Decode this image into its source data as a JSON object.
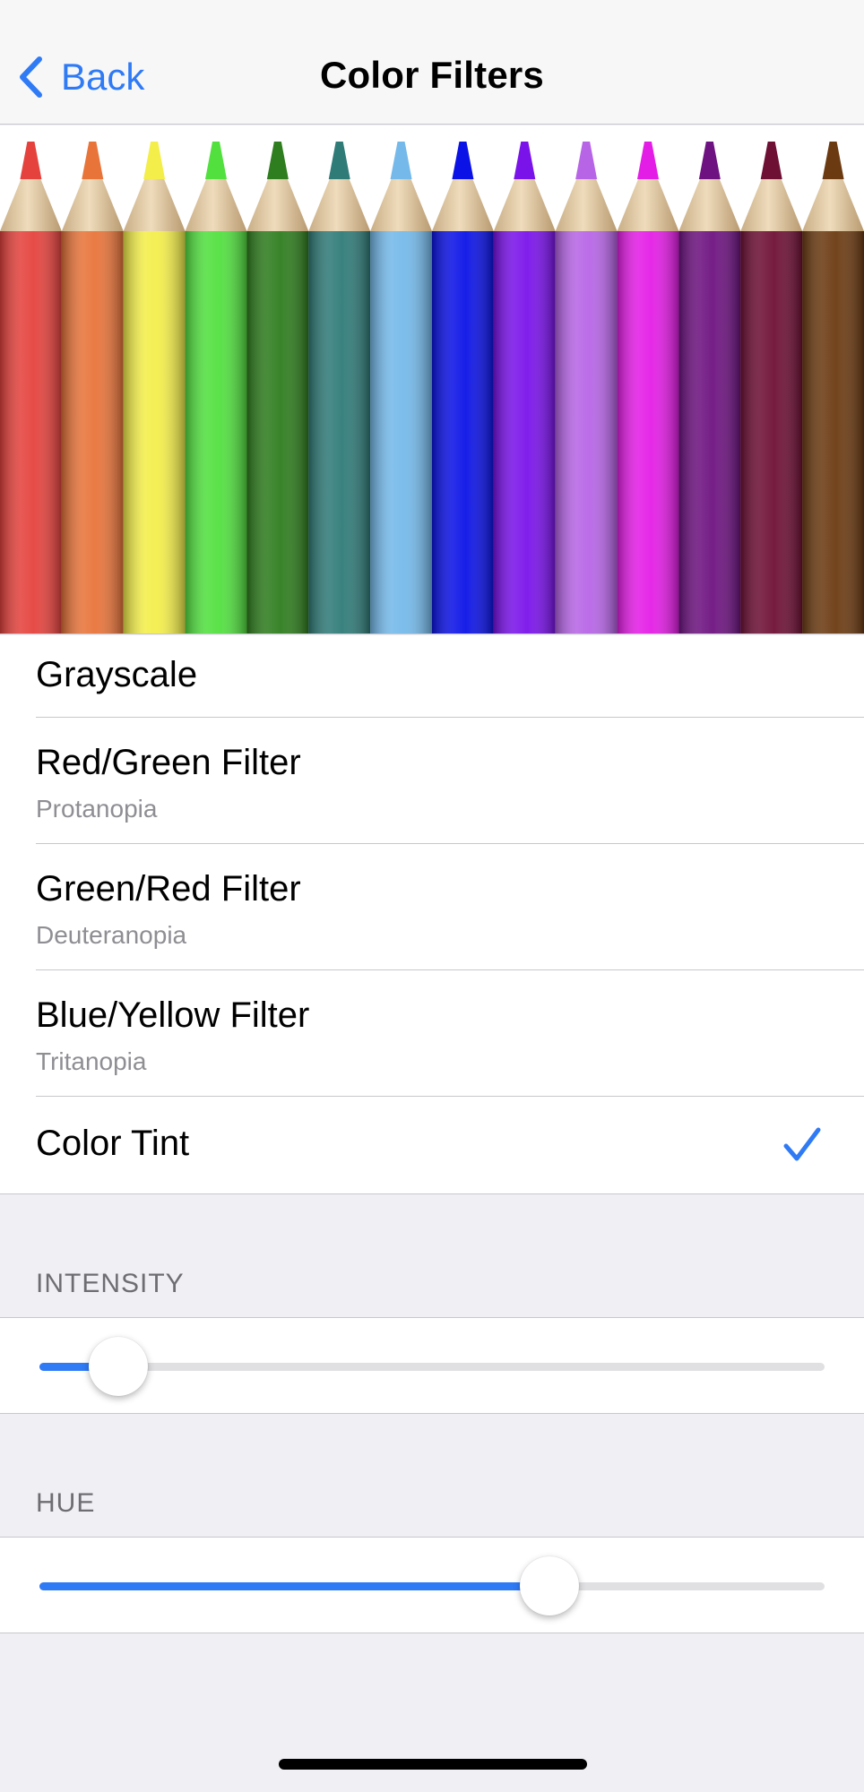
{
  "nav": {
    "back_label": "Back",
    "title": "Color Filters"
  },
  "preview": {
    "page_count": 3,
    "active_page": 1,
    "pencil_colors": [
      "#e5423d",
      "#e8743a",
      "#f3ee4a",
      "#52e03f",
      "#2e7d1e",
      "#2f7b78",
      "#74b9ea",
      "#0b12e6",
      "#7a12ea",
      "#b765e6",
      "#e41de6",
      "#6d1280",
      "#6e0f34",
      "#6b3a11"
    ]
  },
  "filters": [
    {
      "title": "Grayscale",
      "subtitle": "",
      "selected": false
    },
    {
      "title": "Red/Green Filter",
      "subtitle": "Protanopia",
      "selected": false
    },
    {
      "title": "Green/Red Filter",
      "subtitle": "Deuteranopia",
      "selected": false
    },
    {
      "title": "Blue/Yellow Filter",
      "subtitle": "Tritanopia",
      "selected": false
    },
    {
      "title": "Color Tint",
      "subtitle": "",
      "selected": true
    }
  ],
  "intensity": {
    "header": "INTENSITY",
    "value": 0.1
  },
  "hue": {
    "header": "HUE",
    "value": 0.65
  },
  "colors": {
    "accent": "#2f7af5",
    "background": "#efeff4"
  }
}
